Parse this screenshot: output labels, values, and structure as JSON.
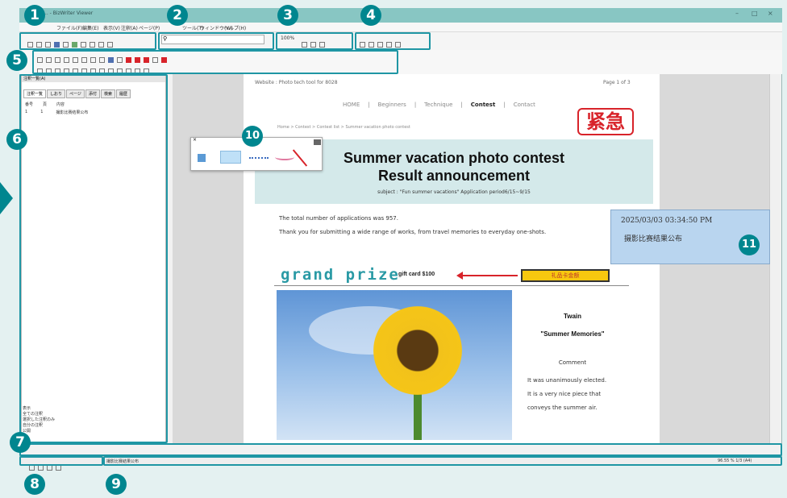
{
  "app": {
    "title": "... - BizWriter Viewer"
  },
  "menu": [
    "ファイル(F)",
    "編集(E)",
    "表示(V)",
    "注釈(A)",
    "ページ(P)",
    "ツール(T)",
    "ウィンドウ(W)",
    "ヘルプ(H)"
  ],
  "toolbar": {
    "search_placeholder": "",
    "zoom": "100%"
  },
  "panel": {
    "title": "注釈一覧(A)",
    "tabs": [
      "注釈一覧",
      "しおり",
      "ページ",
      "添付",
      "検索",
      "履歴"
    ],
    "columns": [
      "番号",
      "頁",
      "内容"
    ],
    "row": {
      "num": "1",
      "page": "1",
      "content": "撮影比赛结果公布"
    },
    "filters": [
      "表示",
      "全ての注釈",
      "選択した注釈のみ",
      "自分の注釈",
      "公開"
    ]
  },
  "doc": {
    "header_site": "Website : Photo tech tool for 8028",
    "page_info": "Page 1 of 3",
    "nav": [
      "HOME",
      "Beginners",
      "Technique",
      "Contest",
      "Contact"
    ],
    "breadcrumb": "Home > Contest > Contest list > Summer vacation photo contest",
    "heading1": "Summer vacation photo contest",
    "heading2": "Result announcement",
    "subject": "subject : \"Fun summer vacations\" Application period6/15~9/15",
    "para1": "The total number of applications was 957.",
    "para2": "Thank you for submitting a wide range of works, from travel memories to everyday one-shots.",
    "grand_prize": "grand prize",
    "gift": "gift card $100",
    "gift_tag": "礼品卡金额",
    "stamp": "紧急",
    "winner_name": "Twain",
    "work_title": "\"Summer Memories\"",
    "comment_label": "Comment",
    "comment": [
      "It was unanimously elected.",
      "It is a very nice piece that",
      "conveys the summer air."
    ]
  },
  "note": {
    "timestamp": "2025/03/03 03:34:50 PM",
    "text": "摄影比赛结果公布"
  },
  "status": {
    "left": "撮影比赛結果公布",
    "right": "96.55 % 1/3 (A4)"
  },
  "badges": [
    "1",
    "2",
    "3",
    "4",
    "5",
    "6",
    "7",
    "8",
    "9",
    "10",
    "11"
  ],
  "colors": {
    "accent": "#00868f",
    "title_bar": "#88c6c3",
    "grand_prize": "#2a9aa5",
    "stamp_red": "#d8232a",
    "note_bg": "#b9d5ef"
  }
}
